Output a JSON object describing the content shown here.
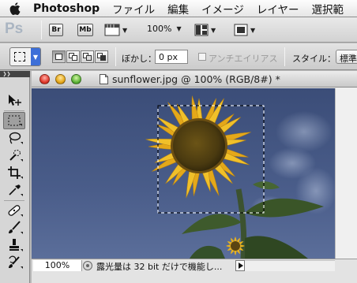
{
  "menubar": {
    "app_name": "Photoshop",
    "items": [
      "ファイル",
      "編集",
      "イメージ",
      "レイヤー",
      "選択範"
    ]
  },
  "appbar": {
    "logo": "Ps",
    "bridge_label": "Br",
    "minibridge_label": "Mb",
    "zoom_value": "100%"
  },
  "options": {
    "feather_label": "ぼかし：",
    "feather_value": "0 px",
    "antialias_label": "アンチエイリアス",
    "antialias_checked": false,
    "style_label": "スタイル：",
    "style_value": "標準"
  },
  "tools": [
    "move",
    "rectangular-marquee",
    "lasso",
    "quick-selection",
    "crop",
    "eyedropper",
    "spot-healing",
    "brush",
    "clone-stamp",
    "history-brush"
  ],
  "selected_tool": "rectangular-marquee",
  "document": {
    "title": "sunflower.jpg @ 100% (RGB/8#) *",
    "zoom": "100%",
    "status": "露光量は 32 bit だけで機能し..."
  },
  "colors": {
    "sky": "#44567f",
    "petal": "#f0c02a",
    "marquee_active": "#3d6fd8"
  }
}
